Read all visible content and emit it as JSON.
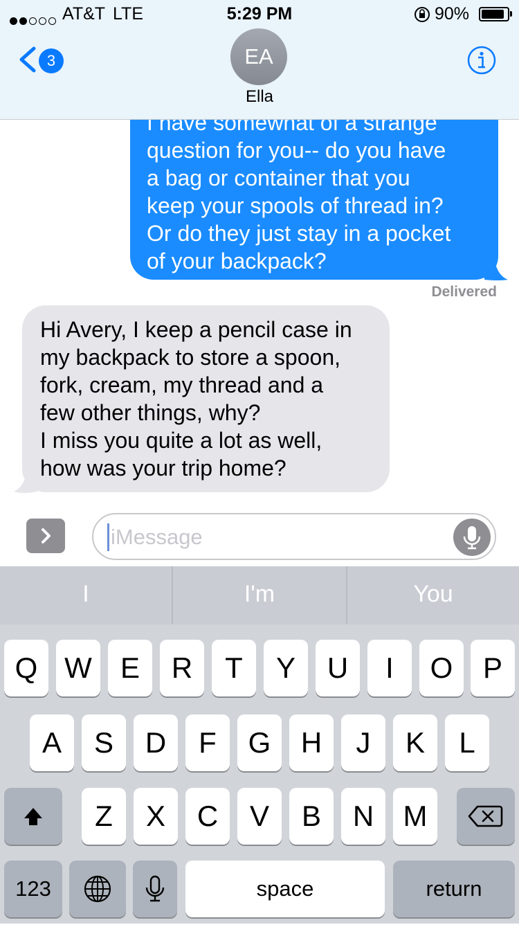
{
  "status_bar": {
    "carrier": "AT&T",
    "network": "LTE",
    "time": "5:29 PM",
    "battery_percent_label": "90%",
    "battery_level": 0.9,
    "signal_bars": 2,
    "signal_total": 5,
    "icons": [
      "orientation-lock-icon",
      "battery-icon"
    ]
  },
  "nav": {
    "back_count": "3",
    "avatar_initials": "EA",
    "contact_name": "Ella",
    "info_icon": "info-icon"
  },
  "messages": [
    {
      "direction": "sent",
      "lines": [
        "I have somewhat of a strange",
        "question for you-- do you have",
        "a bag or container that you",
        "keep your spools of thread in?",
        "Or do they just stay in a pocket",
        "of your backpack?"
      ],
      "status": "Delivered"
    },
    {
      "direction": "received",
      "lines": [
        "Hi Avery, I keep a pencil case in",
        "my backpack to store a spoon,",
        "fork, cream, my thread and a",
        "few other things, why?",
        "I miss you quite a lot as well,",
        "how was your trip home?"
      ]
    }
  ],
  "composer": {
    "placeholder": "iMessage",
    "apps_icon": "chevron-right-icon",
    "mic_icon": "microphone-icon"
  },
  "keyboard": {
    "predictions": [
      "I",
      "I'm",
      "You"
    ],
    "row1": [
      "Q",
      "W",
      "E",
      "R",
      "T",
      "Y",
      "U",
      "I",
      "O",
      "P"
    ],
    "row2": [
      "A",
      "S",
      "D",
      "F",
      "G",
      "H",
      "J",
      "K",
      "L"
    ],
    "row3": [
      "Z",
      "X",
      "C",
      "V",
      "B",
      "N",
      "M"
    ],
    "shift_icon": "shift-arrow-icon",
    "delete_icon": "backspace-icon",
    "numbers_label": "123",
    "globe_icon": "globe-icon",
    "dictation_icon": "microphone-icon",
    "space_label": "space",
    "return_label": "return"
  }
}
